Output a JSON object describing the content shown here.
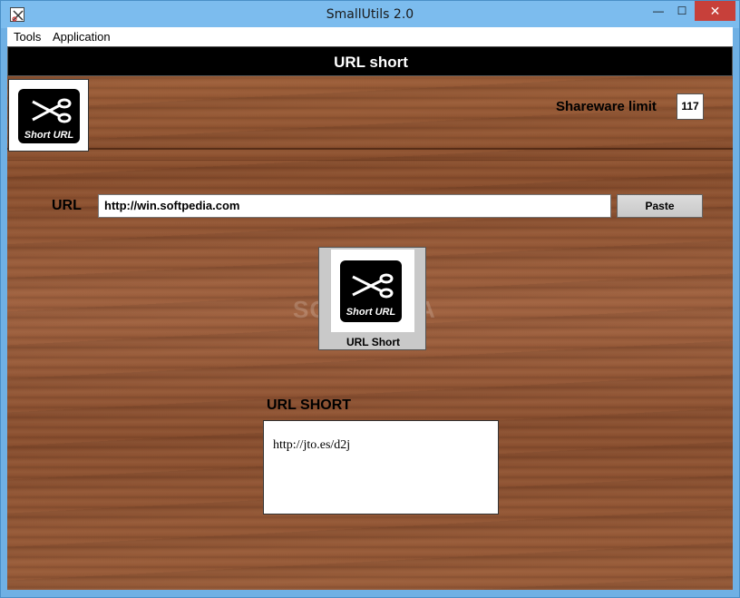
{
  "window": {
    "title": "SmallUtils 2.0",
    "controls": {
      "minimize": "—",
      "maximize": "☐",
      "close": "✕"
    }
  },
  "menu": {
    "items": [
      {
        "label": "Tools"
      },
      {
        "label": "Application"
      }
    ]
  },
  "header": {
    "title": "URL short"
  },
  "logo": {
    "caption": "Short URL",
    "icon": "scissors-icon"
  },
  "shareware": {
    "label": "Shareware limit",
    "value": "117"
  },
  "url_input": {
    "label": "URL",
    "value": "http://win.softpedia.com"
  },
  "paste_button": {
    "label": "Paste"
  },
  "short_button": {
    "label": "URL Short",
    "image_caption": "Short URL"
  },
  "result": {
    "label": "URL SHORT",
    "value": "http://jto.es/d2j"
  },
  "watermark": {
    "text": "SOFTPEDIA"
  }
}
